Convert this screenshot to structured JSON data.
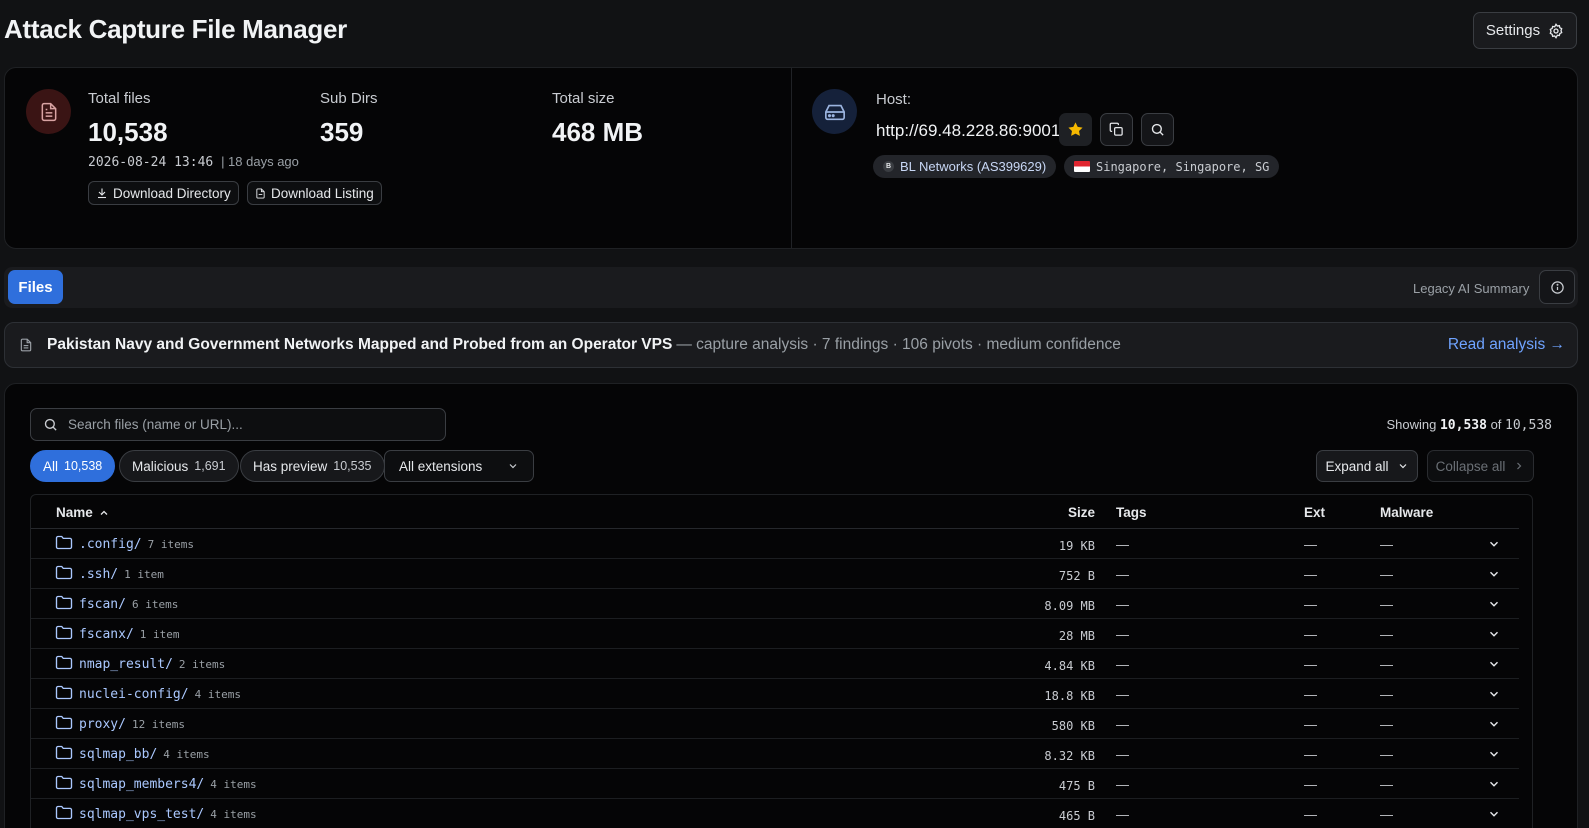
{
  "app": {
    "title": "Attack Capture File Manager",
    "settings_label": "Settings"
  },
  "stats": {
    "total_files_label": "Total files",
    "total_files": "10,538",
    "sub_dirs_label": "Sub Dirs",
    "sub_dirs": "359",
    "total_size_label": "Total size",
    "total_size": "468 MB",
    "timestamp": "2026-08-24 13:46",
    "relative_time": "| 18 days ago",
    "download_directory_label": "Download Directory",
    "download_listing_label": "Download Listing"
  },
  "host": {
    "label": "Host:",
    "url": "http://69.48.228.86:9001",
    "asn_badge_letter": "B",
    "asn_label": "BL Networks (AS399629)",
    "location_label": "Singapore, Singapore, SG"
  },
  "tabs": {
    "files_label": "Files",
    "legacy_summary_label": "Legacy AI Summary"
  },
  "analysis": {
    "title": "Pakistan Navy and Government Networks Mapped and Probed from an Operator VPS",
    "meta": "— capture analysis · 7 findings · 106 pivots · medium confidence",
    "read_label": "Read analysis →"
  },
  "files": {
    "search_placeholder": "Search files (name or URL)...",
    "showing_prefix": "Showing",
    "showing_count": "10,538",
    "showing_of": "of",
    "showing_total": "10,538",
    "filters": [
      {
        "label": "All",
        "count": "10,538",
        "active": true
      },
      {
        "label": "Malicious",
        "count": "1,691",
        "active": false
      },
      {
        "label": "Has preview",
        "count": "10,535",
        "active": false
      }
    ],
    "extension_select": "All extensions",
    "expand_all_label": "Expand all",
    "collapse_all_label": "Collapse all",
    "columns": {
      "name": "Name",
      "size": "Size",
      "tags": "Tags",
      "ext": "Ext",
      "malware": "Malware"
    },
    "rows": [
      {
        "name": ".config/",
        "count": "7 items",
        "size": "19 KB",
        "tags": "—",
        "ext": "—",
        "malware": "—"
      },
      {
        "name": ".ssh/",
        "count": "1 item",
        "size": "752 B",
        "tags": "—",
        "ext": "—",
        "malware": "—"
      },
      {
        "name": "fscan/",
        "count": "6 items",
        "size": "8.09 MB",
        "tags": "—",
        "ext": "—",
        "malware": "—"
      },
      {
        "name": "fscanx/",
        "count": "1 item",
        "size": "28 MB",
        "tags": "—",
        "ext": "—",
        "malware": "—"
      },
      {
        "name": "nmap_result/",
        "count": "2 items",
        "size": "4.84 KB",
        "tags": "—",
        "ext": "—",
        "malware": "—"
      },
      {
        "name": "nuclei-config/",
        "count": "4 items",
        "size": "18.8 KB",
        "tags": "—",
        "ext": "—",
        "malware": "—"
      },
      {
        "name": "proxy/",
        "count": "12 items",
        "size": "580 KB",
        "tags": "—",
        "ext": "—",
        "malware": "—"
      },
      {
        "name": "sqlmap_bb/",
        "count": "4 items",
        "size": "8.32 KB",
        "tags": "—",
        "ext": "—",
        "malware": "—"
      },
      {
        "name": "sqlmap_members4/",
        "count": "4 items",
        "size": "475 B",
        "tags": "—",
        "ext": "—",
        "malware": "—"
      },
      {
        "name": "sqlmap_vps_test/",
        "count": "4 items",
        "size": "465 B",
        "tags": "—",
        "ext": "—",
        "malware": "—"
      }
    ]
  },
  "icons": {
    "settings": "gear-icon",
    "files_stat": "document-icon",
    "host": "hard-drive-icon",
    "favorite": "star-icon",
    "copy": "copy-icon",
    "search": "search-icon",
    "info": "info-icon",
    "folder": "folder-icon",
    "row_expand": "chevron-down-icon"
  },
  "colors": {
    "accent": "#2f6fdc",
    "link": "#6fa3ff",
    "star": "#f5b800",
    "background": "#111214"
  }
}
